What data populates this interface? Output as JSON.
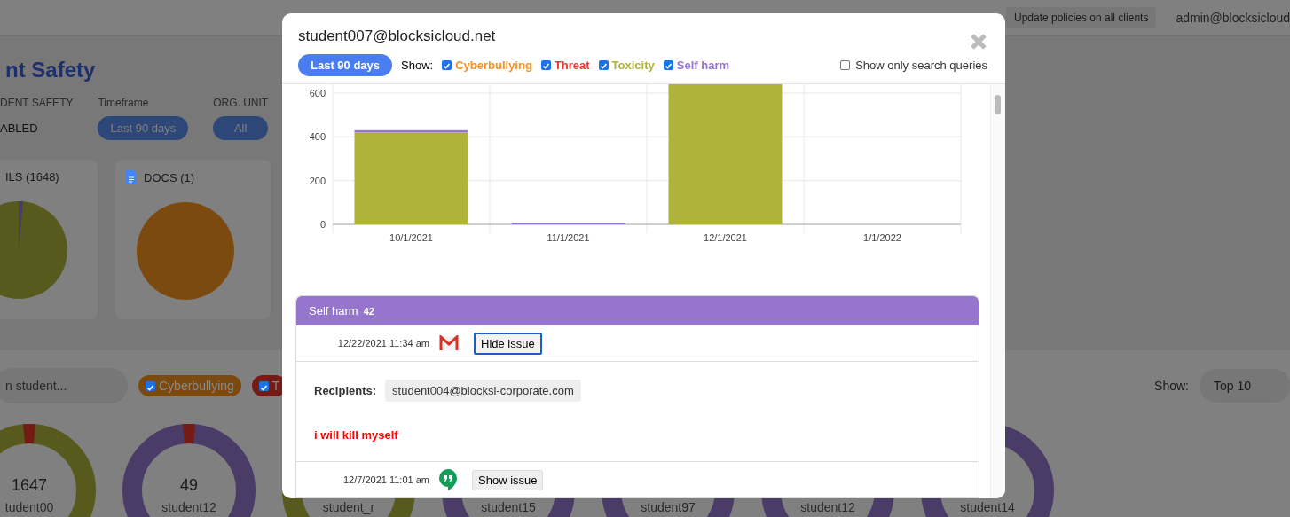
{
  "top_bar": {
    "buttons": [
      "Update policies on all clients"
    ],
    "user": "admin@blocksicloud"
  },
  "page": {
    "title": "nt Safety",
    "filters": [
      {
        "label": "DENT SAFETY",
        "value": "ABLED",
        "kind": "text"
      },
      {
        "label": "Timeframe",
        "value": "Last 90 days",
        "kind": "pill"
      },
      {
        "label": "ORG. UNIT",
        "value": "All",
        "kind": "pill"
      }
    ],
    "cards": [
      {
        "title": "ILS (1648)",
        "kind": "mail",
        "color": "#585a1d"
      },
      {
        "title": "DOCS (1)",
        "kind": "docs",
        "color": "#7c4a0f"
      }
    ],
    "search": {
      "placeholder": "n student..."
    },
    "chips": [
      {
        "label": "Cyberbullying",
        "checked": true,
        "color": "#7c4a0f"
      },
      {
        "label": "T",
        "checked": true,
        "color": "#741b16"
      }
    ],
    "show_label": "Show:",
    "show_value": "Top 10",
    "students": [
      {
        "count": "1647",
        "name": "tudent00",
        "color": "#585a1d"
      },
      {
        "count": "49",
        "name": "student12",
        "color": "#4b3b67"
      },
      {
        "name": "student_r",
        "color": "#585a1d"
      },
      {
        "name": "student15",
        "color": "#4b3b67"
      },
      {
        "name": "student97",
        "color": "#4b3b67"
      },
      {
        "name": "student12",
        "color": "#4b3b67"
      },
      {
        "name": "student14",
        "color": "#4b3b67"
      }
    ]
  },
  "modal": {
    "title": "student007@blocksicloud.net",
    "timeframe": "Last 90 days",
    "show_label": "Show:",
    "categories": [
      {
        "label": "Cyberbullying",
        "checked": true,
        "color": "#f7931e"
      },
      {
        "label": "Threat",
        "checked": true,
        "color": "#f0352b"
      },
      {
        "label": "Toxicity",
        "checked": true,
        "color": "#afb33a"
      },
      {
        "label": "Self harm",
        "checked": true,
        "color": "#9575cd"
      }
    ],
    "search_only": {
      "label": "Show only search queries",
      "checked": false
    },
    "chart_data": {
      "type": "bar",
      "stacked": true,
      "grid": true,
      "categories": [
        "10/1/2021",
        "11/1/2021",
        "12/1/2021",
        "1/1/2022"
      ],
      "series": [
        {
          "color": "#afb33a",
          "values": [
            420,
            0,
            640,
            0
          ]
        },
        {
          "color": "#9575cd",
          "values": [
            10,
            8,
            0,
            0
          ]
        }
      ],
      "ylim": [
        0,
        640
      ],
      "yticks": [
        0,
        200,
        400,
        600
      ]
    },
    "panel": {
      "title": "Self harm",
      "count": "42",
      "color": "#9575cd",
      "issues": [
        {
          "date": "12/22/2021 11:34 am",
          "kind": "gmail",
          "button": "Hide issue",
          "expanded": true,
          "recipients_label": "Recipients:",
          "recipient": "student004@blocksi-corporate.com",
          "message": "i will kill myself"
        },
        {
          "date": "12/7/2021 11:01 am",
          "kind": "hangouts",
          "button": "Show issue",
          "expanded": false
        }
      ]
    }
  }
}
